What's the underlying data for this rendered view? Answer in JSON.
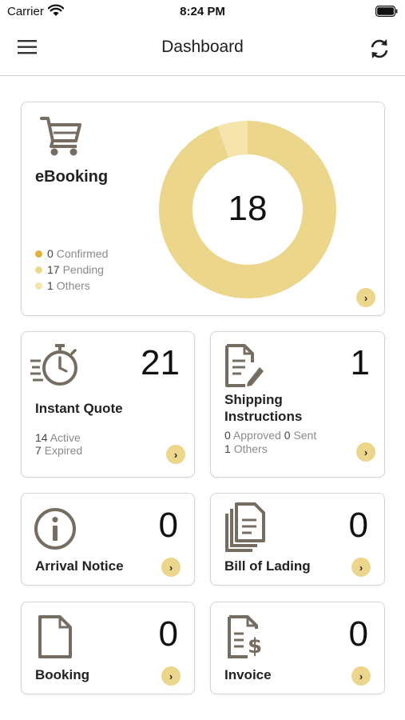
{
  "status_bar": {
    "carrier": "Carrier",
    "time": "8:24 PM"
  },
  "nav": {
    "title": "Dashboard"
  },
  "ebooking": {
    "title": "eBooking",
    "total": "18",
    "legend": [
      {
        "count": "0",
        "label": "Confirmed",
        "color": "#e2b33c"
      },
      {
        "count": "17",
        "label": "Pending",
        "color": "#ecd68b"
      },
      {
        "count": "1",
        "label": "Others",
        "color": "#f6e4ad"
      }
    ],
    "arrow": "›"
  },
  "instant_quote": {
    "title": "Instant Quote",
    "count": "21",
    "active_count": "14",
    "active_label": "Active",
    "expired_count": "7",
    "expired_label": "Expired",
    "arrow": "›"
  },
  "shipping_instructions": {
    "title_line1": "Shipping",
    "title_line2": "Instructions",
    "count": "1",
    "approved_count": "0",
    "approved_label": "Approved",
    "sent_count": "0",
    "sent_label": "Sent",
    "others_count": "1",
    "others_label": "Others",
    "arrow": "›"
  },
  "arrival_notice": {
    "title": "Arrival Notice",
    "count": "0",
    "arrow": "›"
  },
  "bill_of_lading": {
    "title": "Bill of Lading",
    "count": "0",
    "arrow": "›"
  },
  "booking": {
    "title": "Booking",
    "count": "0",
    "arrow": "›"
  },
  "invoice": {
    "title": "Invoice",
    "count": "0",
    "arrow": "›"
  },
  "colors": {
    "accent": "#ecd68b",
    "icon_gray": "#756c62"
  },
  "icons": [
    "wifi-icon",
    "battery-icon",
    "hamburger-menu-icon",
    "refresh-icon",
    "cart-icon",
    "stopwatch-icon",
    "edit-document-icon",
    "info-icon",
    "documents-icon",
    "blank-document-icon",
    "invoice-icon",
    "chevron-right-icon"
  ]
}
